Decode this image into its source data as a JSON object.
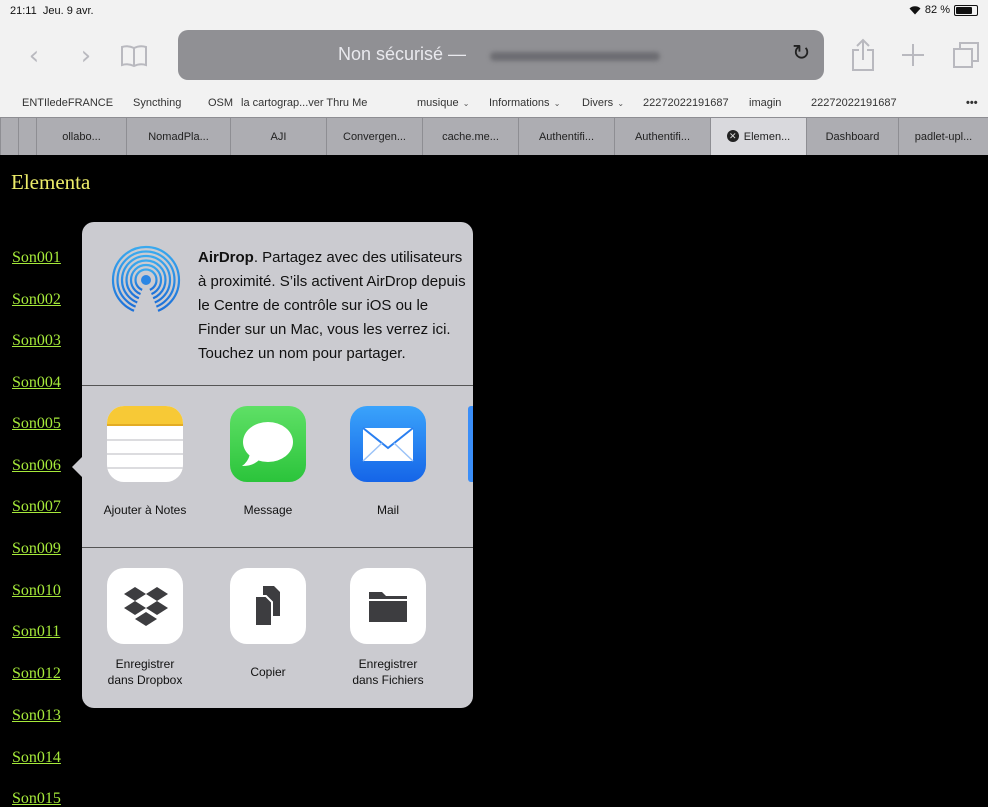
{
  "status_bar": {
    "time": "21:11",
    "date": "Jeu. 9 avr.",
    "battery": "82 %",
    "battery_level": 0.82
  },
  "toolbar": {
    "back_icon": "chevron-left-icon",
    "forward_icon": "chevron-right-icon",
    "bookmarks_icon": "book-icon",
    "address_label": "Non sécurisé —",
    "reload_icon": "reload-icon",
    "share_icon": "share-icon",
    "new_tab_icon": "plus-icon",
    "tabs_icon": "tabs-icon"
  },
  "bookmarks": [
    {
      "label": "ENTIledeFRANCE",
      "has_menu": false
    },
    {
      "label": "Syncthing",
      "has_menu": false
    },
    {
      "label": "OSM",
      "has_menu": false
    },
    {
      "label": "la cartograp...ver Thru Me",
      "has_menu": false
    },
    {
      "label": "musique",
      "has_menu": true
    },
    {
      "label": "Informations",
      "has_menu": true
    },
    {
      "label": "Divers",
      "has_menu": true
    },
    {
      "label": "22272022191687",
      "has_menu": false
    },
    {
      "label": "imagin",
      "has_menu": false
    },
    {
      "label": "22272022191687",
      "has_menu": false
    },
    {
      "label": "•••",
      "has_menu": false
    }
  ],
  "tabs": [
    {
      "label": "",
      "active": false
    },
    {
      "label": "",
      "active": false
    },
    {
      "label": "ollabo...",
      "active": false
    },
    {
      "label": "NomadPla...",
      "active": false
    },
    {
      "label": "AJI",
      "active": false
    },
    {
      "label": "Convergen...",
      "active": false
    },
    {
      "label": "cache.me...",
      "active": false
    },
    {
      "label": "Authentifi...",
      "active": false
    },
    {
      "label": "Authentifi...",
      "active": false
    },
    {
      "label": "Elemen...",
      "active": true,
      "close": "✕"
    },
    {
      "label": "Dashboard",
      "active": false
    },
    {
      "label": "padlet-upl...",
      "active": false
    }
  ],
  "page": {
    "title": "Elementa",
    "links": [
      "Son001",
      "Son002",
      "Son003",
      "Son004",
      "Son005",
      "Son006",
      "Son007",
      "Son009",
      "Son010",
      "Son011",
      "Son012",
      "Son013",
      "Son014",
      "Son015"
    ],
    "link_color": "#a6ea3a",
    "title_color": "#eded6a"
  },
  "share_sheet": {
    "airdrop": {
      "icon": "airdrop-icon",
      "title": "AirDrop",
      "text": ". Partagez avec des utilisateurs à proximité. S’ils activent AirDrop depuis le Centre de contrôle sur iOS ou le Finder sur un Mac, vous les verrez ici. Touchez un nom pour partager."
    },
    "apps": [
      {
        "label": "Ajouter à Notes",
        "icon": "notes-icon"
      },
      {
        "label": "Message",
        "icon": "messages-icon"
      },
      {
        "label": "Mail",
        "icon": "mail-icon"
      }
    ],
    "actions": [
      {
        "line1": "Enregistrer",
        "line2": "dans Dropbox",
        "icon": "dropbox-icon"
      },
      {
        "line1": "Copier",
        "line2": "",
        "icon": "copy-icon"
      },
      {
        "line1": "Enregistrer",
        "line2": "dans Fichiers",
        "icon": "folder-icon"
      }
    ]
  }
}
